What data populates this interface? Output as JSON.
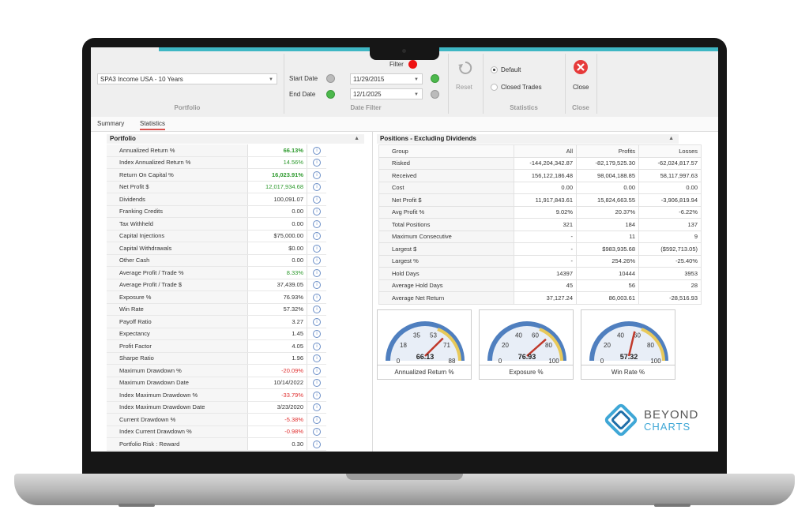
{
  "ribbon": {
    "portfolio_value": "SPA3 Income USA - 10 Years",
    "portfolio_label": "Portfolio",
    "start_date_label": "Start Date",
    "start_date": "11/29/2015",
    "end_date_label": "End Date",
    "end_date": "12/1/2025",
    "filter_label": "Filter",
    "date_filter_label": "Date Filter",
    "reset_label": "Reset",
    "default_label": "Default",
    "closed_trades_label": "Closed Trades",
    "statistics_label": "Statistics",
    "close_button_label": "Close",
    "close_group_label": "Close"
  },
  "tabs": [
    "Summary",
    "Statistics"
  ],
  "portfolio_panel": {
    "title": "Portfolio",
    "rows": [
      {
        "name": "Annualized Return %",
        "value": "66.13%",
        "style": "green bold"
      },
      {
        "name": "Index Annualized Return %",
        "value": "14.56%",
        "style": "green"
      },
      {
        "name": "Return On Capital %",
        "value": "16,023.91%",
        "style": "green bold"
      },
      {
        "name": "Net Profit $",
        "value": "12,017,934.68",
        "style": "green"
      },
      {
        "name": "Dividends",
        "value": "100,091.07",
        "style": ""
      },
      {
        "name": "Franking Credits",
        "value": "0.00",
        "style": ""
      },
      {
        "name": "Tax Withheld",
        "value": "0.00",
        "style": ""
      },
      {
        "name": "Capital Injections",
        "value": "$75,000.00",
        "style": ""
      },
      {
        "name": "Capital Withdrawals",
        "value": "$0.00",
        "style": ""
      },
      {
        "name": "Other Cash",
        "value": "0.00",
        "style": ""
      },
      {
        "name": "Average Profit / Trade %",
        "value": "8.33%",
        "style": "green"
      },
      {
        "name": "Average Profit / Trade $",
        "value": "37,439.05",
        "style": ""
      },
      {
        "name": "Exposure %",
        "value": "76.93%",
        "style": ""
      },
      {
        "name": "Win Rate",
        "value": "57.32%",
        "style": ""
      },
      {
        "name": "Payoff Ratio",
        "value": "3.27",
        "style": ""
      },
      {
        "name": "Expectancy",
        "value": "1.45",
        "style": ""
      },
      {
        "name": "Profit Factor",
        "value": "4.05",
        "style": ""
      },
      {
        "name": "Sharpe Ratio",
        "value": "1.96",
        "style": ""
      },
      {
        "name": "Maximum Drawdown %",
        "value": "-20.09%",
        "style": "red"
      },
      {
        "name": "Maximum Drawdown Date",
        "value": "10/14/2022",
        "style": ""
      },
      {
        "name": "Index Maximum Drawdown %",
        "value": "-33.79%",
        "style": "red"
      },
      {
        "name": "Index Maximum Drawdown Date",
        "value": "3/23/2020",
        "style": ""
      },
      {
        "name": "Current Drawdown %",
        "value": "-5.38%",
        "style": "red"
      },
      {
        "name": "Index Current Drawdown %",
        "value": "-0.98%",
        "style": "red"
      },
      {
        "name": "Portfolio Risk : Reward",
        "value": "0.30",
        "style": ""
      }
    ]
  },
  "positions_panel": {
    "title": "Positions - Excluding Dividends",
    "headers": [
      "Group",
      "All",
      "Profits",
      "Losses"
    ],
    "rows": [
      [
        "Risked",
        "-144,204,342.87",
        "-82,179,525.30",
        "-62,024,817.57"
      ],
      [
        "Received",
        "156,122,186.48",
        "98,004,188.85",
        "58,117,997.63"
      ],
      [
        "Cost",
        "0.00",
        "0.00",
        "0.00"
      ],
      [
        "Net Profit $",
        "11,917,843.61",
        "15,824,663.55",
        "-3,906,819.94"
      ],
      [
        "Avg Profit %",
        "9.02%",
        "20.37%",
        "-6.22%"
      ],
      [
        "Total Positions",
        "321",
        "184",
        "137"
      ],
      [
        "Maximum Consecutive",
        "-",
        "11",
        "9"
      ],
      [
        "Largest $",
        "-",
        "$983,935.68",
        "($592,713.05)"
      ],
      [
        "Largest %",
        "-",
        "254.26%",
        "-25.40%"
      ],
      [
        "Hold Days",
        "14397",
        "10444",
        "3953"
      ],
      [
        "Average Hold Days",
        "45",
        "56",
        "28"
      ],
      [
        "Average Net Return",
        "37,127.24",
        "86,003.61",
        "-28,516.93"
      ]
    ]
  },
  "gauges": [
    {
      "caption": "Annualized Return %",
      "value": 66.13,
      "display": "66.13",
      "min": 0,
      "max": 88,
      "ticks": [
        "0",
        "18",
        "35",
        "53",
        "71",
        "88"
      ]
    },
    {
      "caption": "Exposure %",
      "value": 76.93,
      "display": "76.93",
      "min": 0,
      "max": 100,
      "ticks": [
        "0",
        "20",
        "40",
        "60",
        "80",
        "100"
      ]
    },
    {
      "caption": "Win Rate %",
      "value": 57.32,
      "display": "57.32",
      "min": 0,
      "max": 100,
      "ticks": [
        "0",
        "20",
        "40",
        "60",
        "80",
        "100"
      ]
    }
  ],
  "logo": {
    "line1": "BEYOND",
    "line2": "CHARTS"
  },
  "colors": {
    "accent_teal": "#3fb7c4",
    "positive": "#2e9a2e",
    "negative": "#e03030",
    "close_red": "#e63a3a"
  }
}
